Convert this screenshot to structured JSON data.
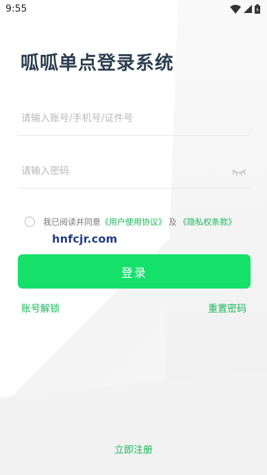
{
  "status_bar": {
    "time": "9:55",
    "icons": [
      "wifi-icon",
      "signal-icon",
      "battery-icon"
    ]
  },
  "title": "呱呱单点登录系统",
  "account_field": {
    "placeholder": "请输入账号/手机号/证件号",
    "value": ""
  },
  "password_field": {
    "placeholder": "请输入密码",
    "value": "",
    "toggle_icon": "eye-closed-icon"
  },
  "agreement": {
    "prefix": "我已阅读并同意",
    "user_agreement": "《用户使用协议》",
    "conjunction": "及",
    "privacy_policy": "《隐私权条款》",
    "checked": false
  },
  "watermark": "hnfcjr.com",
  "login_button": "登录",
  "unlock_link": "账号解锁",
  "reset_link": "重置密码",
  "register_link": "立即注册",
  "colors": {
    "accent": "#14e06a",
    "link": "#19b85a",
    "title": "#2c3e50"
  }
}
